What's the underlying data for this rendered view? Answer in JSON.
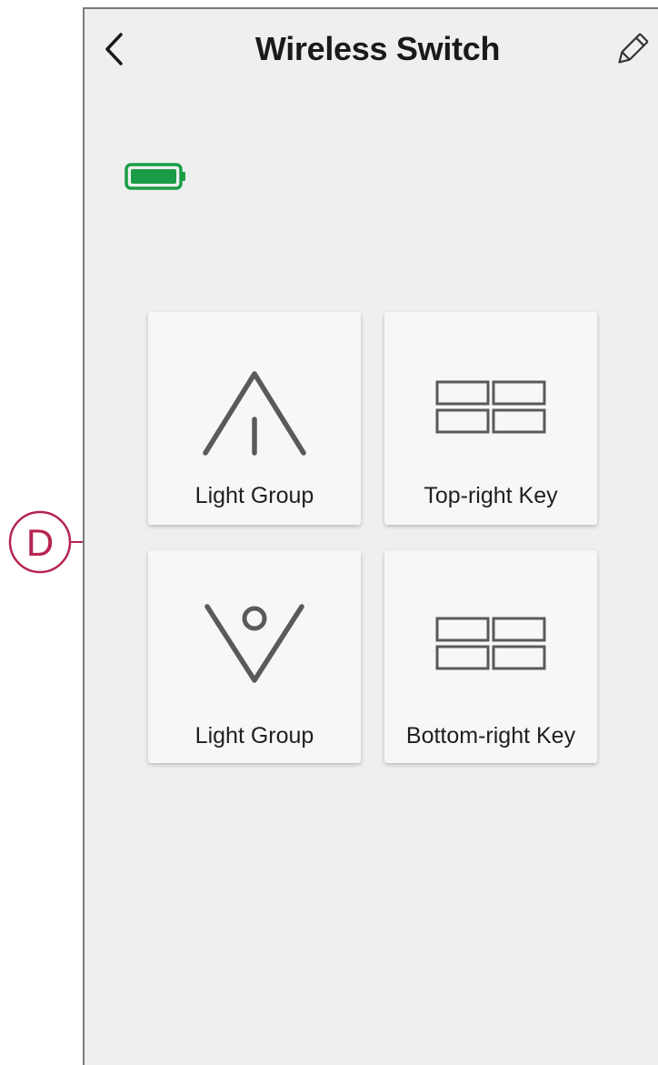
{
  "header": {
    "title": "Wireless Switch",
    "back_icon": "chevron-left-icon",
    "edit_icon": "pencil-icon"
  },
  "battery": {
    "icon": "battery-full-icon",
    "color": "#1a9d46"
  },
  "tiles": [
    {
      "label": "Light Group",
      "icon": "triangle-up-icon"
    },
    {
      "label": "Top-right Key",
      "icon": "four-key-grid-icon"
    },
    {
      "label": "Light Group",
      "icon": "triangle-down-dot-icon"
    },
    {
      "label": "Bottom-right Key",
      "icon": "four-key-grid-icon"
    }
  ],
  "callout": {
    "label": "D",
    "color": "#b5254f"
  }
}
